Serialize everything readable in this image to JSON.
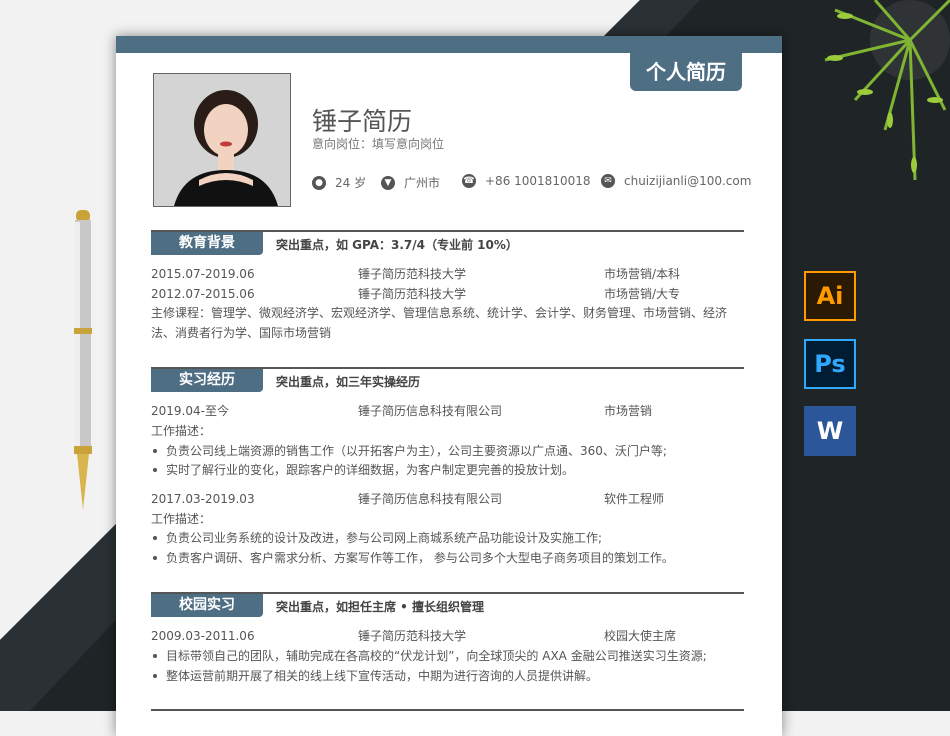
{
  "resume": {
    "tab_title": "个人简历",
    "name": "锤子简历",
    "intent": "意向岗位：填写意向岗位",
    "age": "24 岁",
    "city": "广州市",
    "phone": "+86 1001810018",
    "email": "chuizijianli@100.com",
    "icons": [
      "user-icon",
      "location-icon",
      "phone-icon",
      "mail-icon"
    ]
  },
  "education": {
    "title": "教育背景",
    "highlight": "突出重点，如 GPA：3.7/4（专业前 10%）",
    "rows": [
      {
        "date": "2015.07-2019.06",
        "org": "锤子简历范科技大学",
        "role": "市场营销/本科"
      },
      {
        "date": "2012.07-2015.06",
        "org": "锤子简历范科技大学",
        "role": "市场营销/大专"
      }
    ],
    "courses": "主修课程：管理学、微观经济学、宏观经济学、管理信息系统、统计学、会计学、财务管理、市场营销、经济法、消费者行为学、国际市场营销"
  },
  "internship": {
    "title": "实习经历",
    "highlight": "突出重点，如三年实操经历",
    "jobs": [
      {
        "date": "2019.04-至今",
        "org": "锤子简历信息科技有限公司",
        "role": "市场营销",
        "desc_label": "工作描述：",
        "bullets": [
          "负责公司线上端资源的销售工作（以开拓客户为主），公司主要资源以广点通、360、沃门户等;",
          "实时了解行业的变化，跟踪客户的详细数据，为客户制定更完善的投放计划。"
        ]
      },
      {
        "date": "2017.03-2019.03",
        "org": "锤子简历信息科技有限公司",
        "role": "软件工程师",
        "desc_label": "工作描述：",
        "bullets": [
          "负责公司业务系统的设计及改进，参与公司网上商城系统产品功能设计及实施工作;",
          "负责客户调研、客户需求分析、方案写作等工作， 参与公司多个大型电子商务项目的策划工作。"
        ]
      }
    ]
  },
  "campus": {
    "title": "校园实习",
    "highlight": "突出重点，如担任主席 • 擅长组织管理",
    "row": {
      "date": "2009.03-2011.06",
      "org": "锤子简历范科技大学",
      "role": "校园大使主席"
    },
    "bullets": [
      "目标带领自己的团队，辅助完成在各高校的“伏龙计划”，向全球顶尖的 AXA 金融公司推送实习生资源;",
      "整体运营前期开展了相关的线上线下宣传活动，中期为进行咨询的人员提供讲解。"
    ]
  },
  "apps": {
    "ai": "Ai",
    "ps": "Ps",
    "word": "W"
  },
  "colors": {
    "accent": "#4e6e84",
    "dark_bg": "#1f2427",
    "ai_orange": "#ff9a00",
    "ps_blue": "#31a8ff",
    "word_blue": "#2b579a"
  }
}
